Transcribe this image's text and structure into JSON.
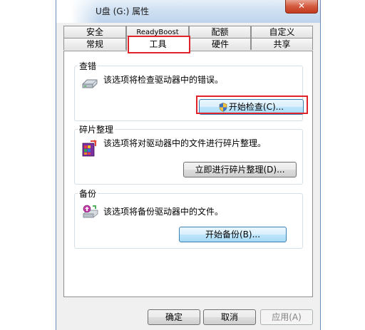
{
  "window": {
    "title": "U盘 (G:) 属性",
    "close_label": "✕"
  },
  "tabs": {
    "row_top": [
      "安全",
      "ReadyBoost",
      "配额",
      "自定义"
    ],
    "row_bottom": [
      "常规",
      "工具",
      "硬件",
      "共享"
    ],
    "selected": "工具"
  },
  "groups": {
    "check": {
      "title": "查错",
      "description": "该选项将检查驱动器中的错误。",
      "button": "开始检查(C)...",
      "icon": "drive-icon"
    },
    "defrag": {
      "title": "碎片整理",
      "description": "该选项将对驱动器中的文件进行碎片整理。",
      "button": "立即进行碎片整理(D)...",
      "icon": "defrag-icon"
    },
    "backup": {
      "title": "备份",
      "description": "该选项将备份驱动器中的文件。",
      "button": "开始备份(B)...",
      "icon": "backup-icon"
    }
  },
  "footer": {
    "ok": "确定",
    "cancel": "取消",
    "apply": "应用(A)"
  },
  "colors": {
    "highlight": "#e0232b",
    "focus_blue": "#3c7fb1"
  }
}
